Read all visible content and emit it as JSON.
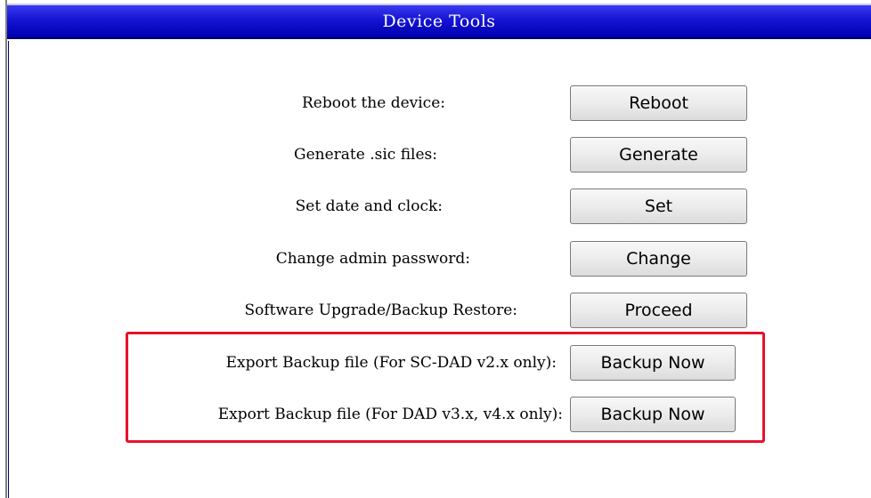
{
  "header": {
    "title": "Device Tools"
  },
  "tools": [
    {
      "label": "Reboot the device:",
      "button": "Reboot"
    },
    {
      "label": "Generate .sic files:",
      "button": "Generate"
    },
    {
      "label": "Set date and clock:",
      "button": "Set"
    },
    {
      "label": "Change admin password:",
      "button": "Change"
    },
    {
      "label": "Software Upgrade/Backup Restore:",
      "button": "Proceed"
    }
  ],
  "backup_exports": [
    {
      "label": "Export Backup file (For SC-DAD v2.x only):",
      "button": "Backup Now"
    },
    {
      "label": "Export Backup file (For DAD v3.x, v4.x only):",
      "button": "Backup Now"
    }
  ],
  "colors": {
    "titlebar": "#1414d4",
    "highlight": "#e8112d"
  }
}
